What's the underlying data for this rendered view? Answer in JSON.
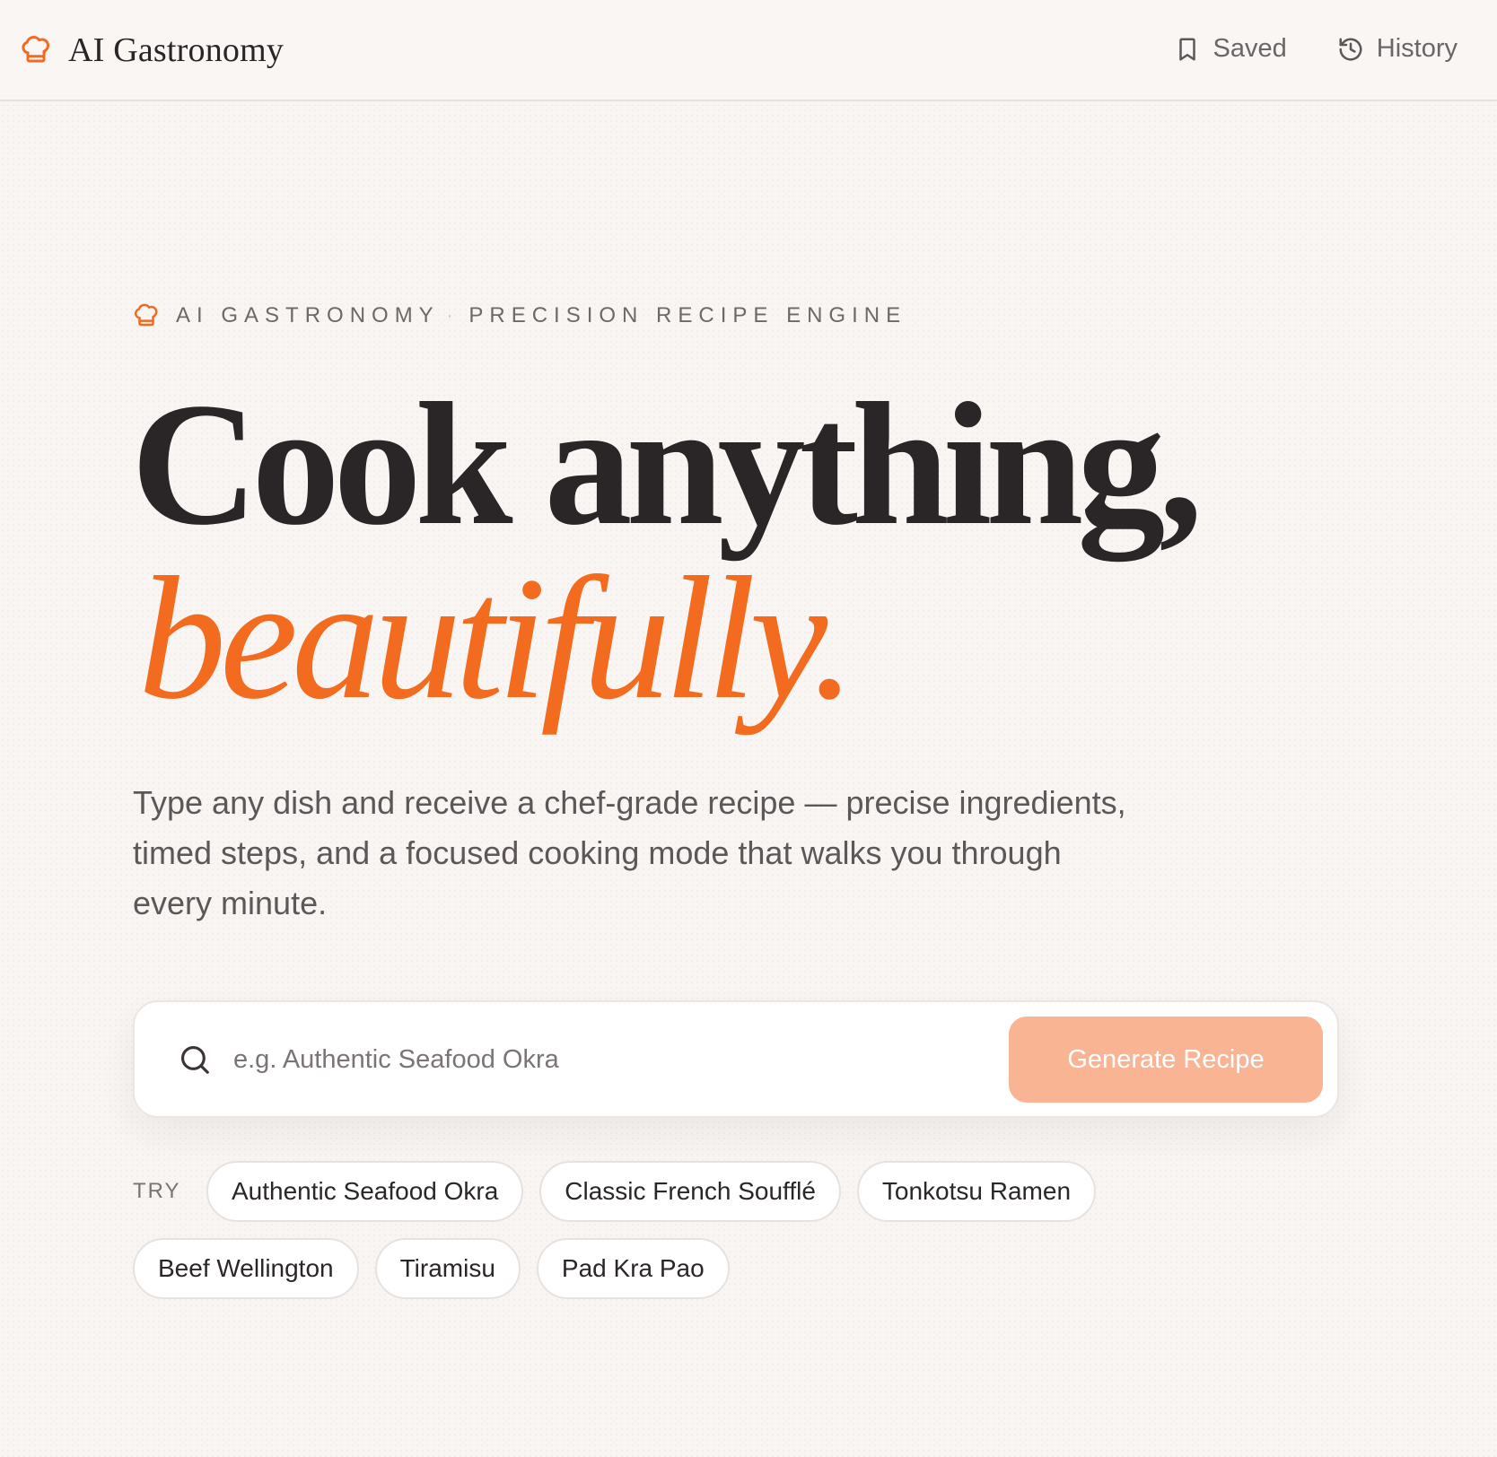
{
  "header": {
    "brand_name": "AI Gastronomy",
    "brand_icon": "chef-hat-icon",
    "nav": [
      {
        "label": "Saved",
        "icon": "bookmark-icon"
      },
      {
        "label": "History",
        "icon": "history-icon"
      }
    ]
  },
  "hero": {
    "eyebrow_brand": "AI GASTRONOMY",
    "eyebrow_separator": "·",
    "eyebrow_tagline": "PRECISION RECIPE ENGINE",
    "headline_line1": "Cook anything,",
    "headline_line2": "beautifully.",
    "lede": "Type any dish and receive a chef-grade recipe — precise ingredients, timed steps, and a focused cooking mode that walks you through every minute."
  },
  "search": {
    "value": "",
    "placeholder": "e.g. Authentic Seafood Okra",
    "button_label": "Generate Recipe"
  },
  "suggestions": {
    "label": "TRY",
    "row1": [
      "Authentic Seafood Okra",
      "Classic French Soufflé",
      "Tonkotsu Ramen"
    ],
    "row2": [
      "Beef Wellington",
      "Tiramisu",
      "Pad Kra Pao"
    ]
  },
  "colors": {
    "accent": "#f26b1f",
    "button_disabled": "#f9b494",
    "text_dark": "#2a2527",
    "text_muted": "#6f6769",
    "background": "#f8f5f3"
  }
}
